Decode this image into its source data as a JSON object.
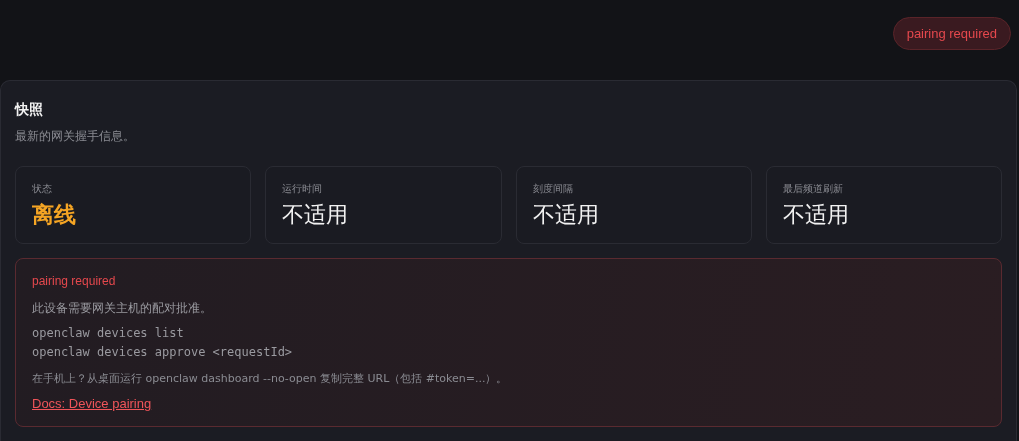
{
  "header": {
    "badge": "pairing required"
  },
  "snapshot": {
    "title": "快照",
    "subtitle": "最新的网关握手信息。",
    "stats": [
      {
        "label": "状态",
        "value": "离线",
        "kind": "warning"
      },
      {
        "label": "运行时间",
        "value": "不适用",
        "kind": "plain"
      },
      {
        "label": "刻度间隔",
        "value": "不适用",
        "kind": "plain"
      },
      {
        "label": "最后频道刷新",
        "value": "不适用",
        "kind": "plain"
      }
    ],
    "alert": {
      "title": "pairing required",
      "message": "此设备需要网关主机的配对批准。",
      "commands": [
        "openclaw devices list",
        "openclaw devices approve <requestId>"
      ],
      "hint": "在手机上？从桌面运行 openclaw dashboard --no-open 复制完整 URL（包括 #token=...）。",
      "link": "Docs: Device pairing"
    }
  }
}
